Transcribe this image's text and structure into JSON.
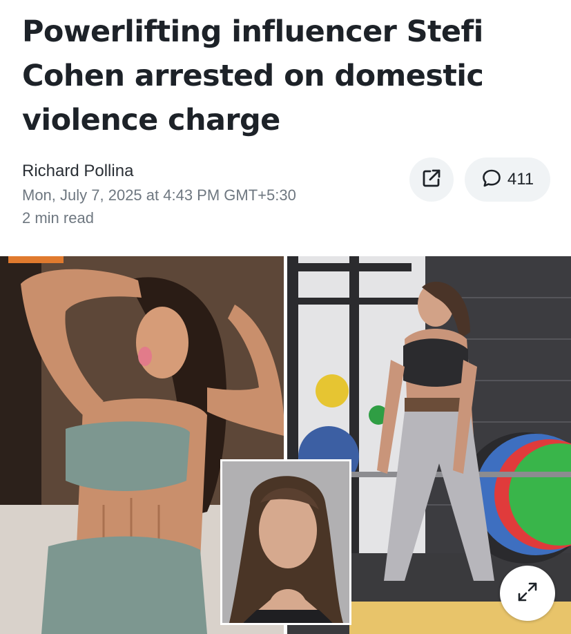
{
  "article": {
    "headline": "Powerlifting influencer Stefi Cohen arrested on domestic violence charge",
    "author": "Richard Pollina",
    "timestamp": "Mon, July 7, 2025 at 4:43 PM GMT+5:30",
    "read_time": "2 min read"
  },
  "actions": {
    "share_icon": "share-icon",
    "comment_icon": "comment-bubble-icon",
    "comment_count": "411",
    "expand_icon": "expand-icon"
  },
  "colors": {
    "headline": "#1d2228",
    "meta": "#6e7780",
    "pill_bg": "#f0f3f5"
  }
}
